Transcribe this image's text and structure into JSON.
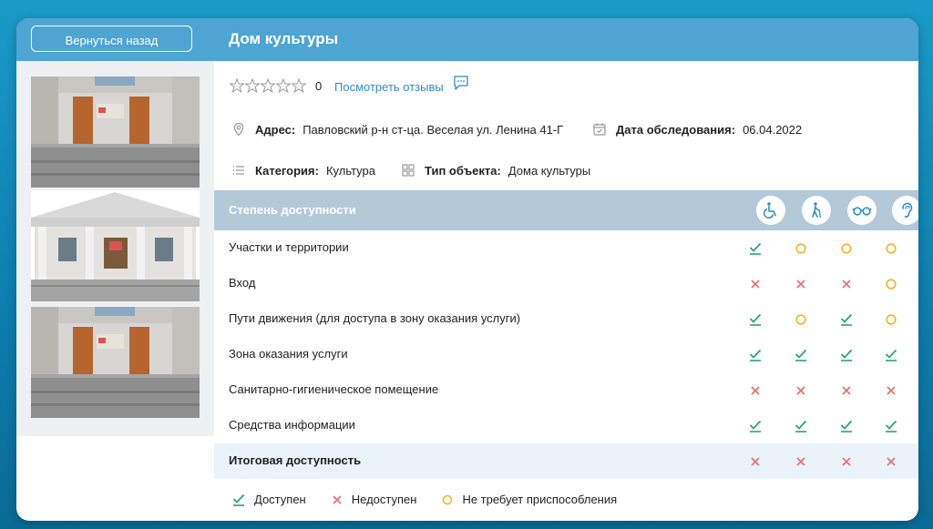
{
  "header": {
    "back_label": "Вернуться назад",
    "title": "Дом культуры"
  },
  "rating": {
    "stars_filled": 0,
    "stars_total": 5,
    "count": "0",
    "reviews_link": "Посмотреть отзывы"
  },
  "info": {
    "address_label": "Адрес:",
    "address_value": "Павловский р-н ст-ца. Веселая ул. Ленина 41-Г",
    "date_label": "Дата обследования:",
    "date_value": "06.04.2022",
    "category_label": "Категория:",
    "category_value": "Культура",
    "type_label": "Тип объекта:",
    "type_value": "Дома культуры"
  },
  "table": {
    "header_label": "Степень доступности",
    "columns": [
      "wheelchair-icon",
      "walking-cane-icon",
      "glasses-icon",
      "ear-icon"
    ],
    "rows": [
      {
        "label": "Участки и территории",
        "marks": [
          "yes",
          "na",
          "na",
          "na"
        ]
      },
      {
        "label": "Вход",
        "marks": [
          "no",
          "no",
          "no",
          "na"
        ]
      },
      {
        "label": "Пути движения (для доступа в зону оказания услуги)",
        "marks": [
          "yes",
          "na",
          "yes",
          "na"
        ]
      },
      {
        "label": "Зона оказания услуги",
        "marks": [
          "yes",
          "yes",
          "yes",
          "yes"
        ]
      },
      {
        "label": "Санитарно-гигиеническое помещение",
        "marks": [
          "no",
          "no",
          "no",
          "no"
        ]
      },
      {
        "label": "Средства информации",
        "marks": [
          "yes",
          "yes",
          "yes",
          "yes"
        ]
      }
    ],
    "total": {
      "label": "Итоговая доступность",
      "marks": [
        "no",
        "no",
        "no",
        "no"
      ]
    }
  },
  "legend": {
    "yes_label": "Доступен",
    "no_label": "Недоступен",
    "na_label": "Не требует приспособления"
  },
  "colors": {
    "header_bg": "#4ea4d3",
    "table_header_bg": "#b3c9d8",
    "yes": "#2aa37c",
    "no": "#e57373",
    "na": "#f0b429",
    "link": "#2f8ec7"
  }
}
